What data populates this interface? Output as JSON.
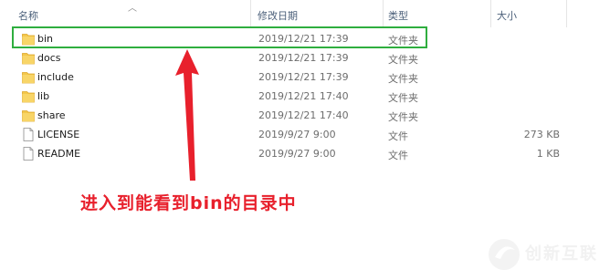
{
  "columns": {
    "name": "名称",
    "date": "修改日期",
    "type": "类型",
    "size": "大小"
  },
  "files": [
    {
      "name": "bin",
      "date": "2019/12/21 17:39",
      "type": "文件夹",
      "size": "",
      "kind": "folder"
    },
    {
      "name": "docs",
      "date": "2019/12/21 17:39",
      "type": "文件夹",
      "size": "",
      "kind": "folder"
    },
    {
      "name": "include",
      "date": "2019/12/21 17:39",
      "type": "文件夹",
      "size": "",
      "kind": "folder"
    },
    {
      "name": "lib",
      "date": "2019/12/21 17:40",
      "type": "文件夹",
      "size": "",
      "kind": "folder"
    },
    {
      "name": "share",
      "date": "2019/12/21 17:40",
      "type": "文件夹",
      "size": "",
      "kind": "folder"
    },
    {
      "name": "LICENSE",
      "date": "2019/9/27 9:00",
      "type": "文件",
      "size": "273 KB",
      "kind": "file"
    },
    {
      "name": "README",
      "date": "2019/9/27 9:00",
      "type": "文件",
      "size": "1 KB",
      "kind": "file"
    }
  ],
  "annotation": {
    "text": "进入到能看到bin的目录中"
  },
  "watermark": {
    "text": "创新互联"
  },
  "colors": {
    "highlight": "#2fae3f",
    "annotation": "#e8202c",
    "folder": "#f3c74b"
  }
}
